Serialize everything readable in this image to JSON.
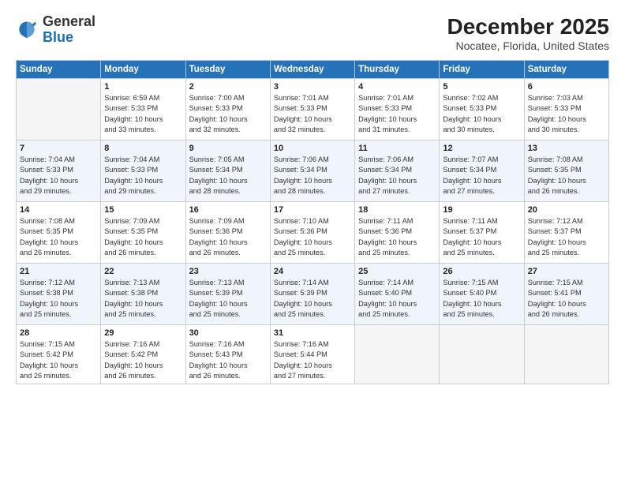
{
  "header": {
    "logo_general": "General",
    "logo_blue": "Blue",
    "month_title": "December 2025",
    "location": "Nocatee, Florida, United States"
  },
  "days_of_week": [
    "Sunday",
    "Monday",
    "Tuesday",
    "Wednesday",
    "Thursday",
    "Friday",
    "Saturday"
  ],
  "weeks": [
    [
      {
        "day": "",
        "empty": true
      },
      {
        "day": "1",
        "sunrise": "Sunrise: 6:59 AM",
        "sunset": "Sunset: 5:33 PM",
        "daylight": "Daylight: 10 hours and 33 minutes."
      },
      {
        "day": "2",
        "sunrise": "Sunrise: 7:00 AM",
        "sunset": "Sunset: 5:33 PM",
        "daylight": "Daylight: 10 hours and 32 minutes."
      },
      {
        "day": "3",
        "sunrise": "Sunrise: 7:01 AM",
        "sunset": "Sunset: 5:33 PM",
        "daylight": "Daylight: 10 hours and 32 minutes."
      },
      {
        "day": "4",
        "sunrise": "Sunrise: 7:01 AM",
        "sunset": "Sunset: 5:33 PM",
        "daylight": "Daylight: 10 hours and 31 minutes."
      },
      {
        "day": "5",
        "sunrise": "Sunrise: 7:02 AM",
        "sunset": "Sunset: 5:33 PM",
        "daylight": "Daylight: 10 hours and 30 minutes."
      },
      {
        "day": "6",
        "sunrise": "Sunrise: 7:03 AM",
        "sunset": "Sunset: 5:33 PM",
        "daylight": "Daylight: 10 hours and 30 minutes."
      }
    ],
    [
      {
        "day": "7",
        "sunrise": "Sunrise: 7:04 AM",
        "sunset": "Sunset: 5:33 PM",
        "daylight": "Daylight: 10 hours and 29 minutes."
      },
      {
        "day": "8",
        "sunrise": "Sunrise: 7:04 AM",
        "sunset": "Sunset: 5:33 PM",
        "daylight": "Daylight: 10 hours and 29 minutes."
      },
      {
        "day": "9",
        "sunrise": "Sunrise: 7:05 AM",
        "sunset": "Sunset: 5:34 PM",
        "daylight": "Daylight: 10 hours and 28 minutes."
      },
      {
        "day": "10",
        "sunrise": "Sunrise: 7:06 AM",
        "sunset": "Sunset: 5:34 PM",
        "daylight": "Daylight: 10 hours and 28 minutes."
      },
      {
        "day": "11",
        "sunrise": "Sunrise: 7:06 AM",
        "sunset": "Sunset: 5:34 PM",
        "daylight": "Daylight: 10 hours and 27 minutes."
      },
      {
        "day": "12",
        "sunrise": "Sunrise: 7:07 AM",
        "sunset": "Sunset: 5:34 PM",
        "daylight": "Daylight: 10 hours and 27 minutes."
      },
      {
        "day": "13",
        "sunrise": "Sunrise: 7:08 AM",
        "sunset": "Sunset: 5:35 PM",
        "daylight": "Daylight: 10 hours and 26 minutes."
      }
    ],
    [
      {
        "day": "14",
        "sunrise": "Sunrise: 7:08 AM",
        "sunset": "Sunset: 5:35 PM",
        "daylight": "Daylight: 10 hours and 26 minutes."
      },
      {
        "day": "15",
        "sunrise": "Sunrise: 7:09 AM",
        "sunset": "Sunset: 5:35 PM",
        "daylight": "Daylight: 10 hours and 26 minutes."
      },
      {
        "day": "16",
        "sunrise": "Sunrise: 7:09 AM",
        "sunset": "Sunset: 5:36 PM",
        "daylight": "Daylight: 10 hours and 26 minutes."
      },
      {
        "day": "17",
        "sunrise": "Sunrise: 7:10 AM",
        "sunset": "Sunset: 5:36 PM",
        "daylight": "Daylight: 10 hours and 25 minutes."
      },
      {
        "day": "18",
        "sunrise": "Sunrise: 7:11 AM",
        "sunset": "Sunset: 5:36 PM",
        "daylight": "Daylight: 10 hours and 25 minutes."
      },
      {
        "day": "19",
        "sunrise": "Sunrise: 7:11 AM",
        "sunset": "Sunset: 5:37 PM",
        "daylight": "Daylight: 10 hours and 25 minutes."
      },
      {
        "day": "20",
        "sunrise": "Sunrise: 7:12 AM",
        "sunset": "Sunset: 5:37 PM",
        "daylight": "Daylight: 10 hours and 25 minutes."
      }
    ],
    [
      {
        "day": "21",
        "sunrise": "Sunrise: 7:12 AM",
        "sunset": "Sunset: 5:38 PM",
        "daylight": "Daylight: 10 hours and 25 minutes."
      },
      {
        "day": "22",
        "sunrise": "Sunrise: 7:13 AM",
        "sunset": "Sunset: 5:38 PM",
        "daylight": "Daylight: 10 hours and 25 minutes."
      },
      {
        "day": "23",
        "sunrise": "Sunrise: 7:13 AM",
        "sunset": "Sunset: 5:39 PM",
        "daylight": "Daylight: 10 hours and 25 minutes."
      },
      {
        "day": "24",
        "sunrise": "Sunrise: 7:14 AM",
        "sunset": "Sunset: 5:39 PM",
        "daylight": "Daylight: 10 hours and 25 minutes."
      },
      {
        "day": "25",
        "sunrise": "Sunrise: 7:14 AM",
        "sunset": "Sunset: 5:40 PM",
        "daylight": "Daylight: 10 hours and 25 minutes."
      },
      {
        "day": "26",
        "sunrise": "Sunrise: 7:15 AM",
        "sunset": "Sunset: 5:40 PM",
        "daylight": "Daylight: 10 hours and 25 minutes."
      },
      {
        "day": "27",
        "sunrise": "Sunrise: 7:15 AM",
        "sunset": "Sunset: 5:41 PM",
        "daylight": "Daylight: 10 hours and 26 minutes."
      }
    ],
    [
      {
        "day": "28",
        "sunrise": "Sunrise: 7:15 AM",
        "sunset": "Sunset: 5:42 PM",
        "daylight": "Daylight: 10 hours and 26 minutes."
      },
      {
        "day": "29",
        "sunrise": "Sunrise: 7:16 AM",
        "sunset": "Sunset: 5:42 PM",
        "daylight": "Daylight: 10 hours and 26 minutes."
      },
      {
        "day": "30",
        "sunrise": "Sunrise: 7:16 AM",
        "sunset": "Sunset: 5:43 PM",
        "daylight": "Daylight: 10 hours and 26 minutes."
      },
      {
        "day": "31",
        "sunrise": "Sunrise: 7:16 AM",
        "sunset": "Sunset: 5:44 PM",
        "daylight": "Daylight: 10 hours and 27 minutes."
      },
      {
        "day": "",
        "empty": true
      },
      {
        "day": "",
        "empty": true
      },
      {
        "day": "",
        "empty": true
      }
    ]
  ]
}
